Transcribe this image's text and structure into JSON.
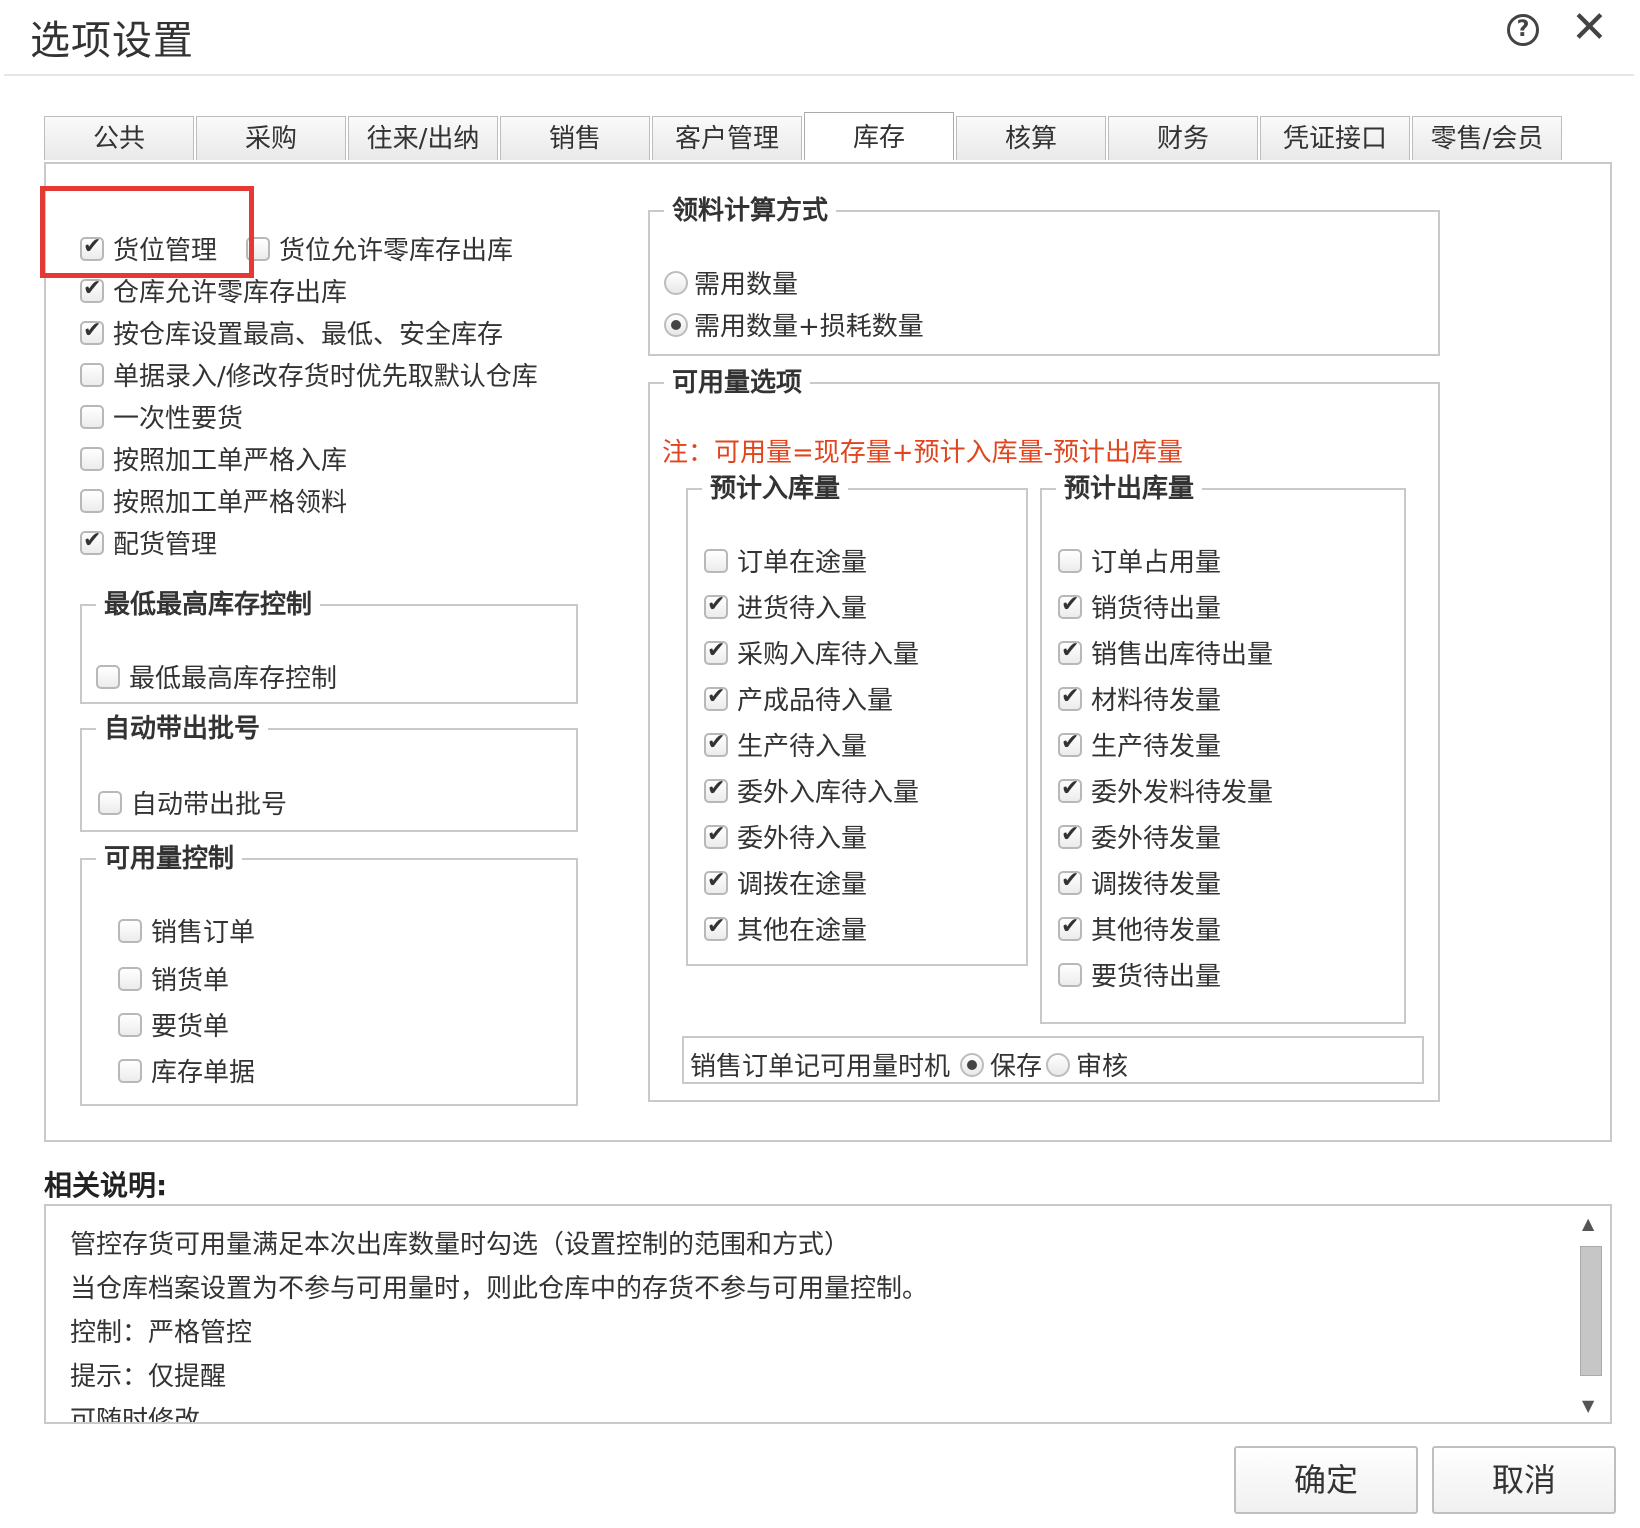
{
  "dialog": {
    "title": "选项设置",
    "help_icon": "?",
    "close_icon": "✕"
  },
  "tabs": [
    {
      "label": "公共",
      "active": false
    },
    {
      "label": "采购",
      "active": false
    },
    {
      "label": "往来/出纳",
      "active": false
    },
    {
      "label": "销售",
      "active": false
    },
    {
      "label": "客户管理",
      "active": false
    },
    {
      "label": "库存",
      "active": true
    },
    {
      "label": "核算",
      "active": false
    },
    {
      "label": "财务",
      "active": false
    },
    {
      "label": "凭证接口",
      "active": false
    },
    {
      "label": "零售/会员",
      "active": false
    }
  ],
  "left_options": {
    "location_mgmt": {
      "label": "货位管理",
      "checked": true
    },
    "location_zero_stock": {
      "label": "货位允许零库存出库",
      "checked": false
    },
    "warehouse_zero_stock": {
      "label": "仓库允许零库存出库",
      "checked": true
    },
    "warehouse_limits": {
      "label": "按仓库设置最高、最低、安全库存",
      "checked": true
    },
    "default_warehouse": {
      "label": "单据录入/修改存货时优先取默认仓库",
      "checked": false
    },
    "one_time_request": {
      "label": "一次性要货",
      "checked": false
    },
    "strict_inbound": {
      "label": "按照加工单严格入库",
      "checked": false
    },
    "strict_material": {
      "label": "按照加工单严格领料",
      "checked": false
    },
    "distribution_mgmt": {
      "label": "配货管理",
      "checked": true
    }
  },
  "min_max_group": {
    "title": "最低最高库存控制",
    "option": {
      "label": "最低最高库存控制",
      "checked": false
    }
  },
  "auto_batch_group": {
    "title": "自动带出批号",
    "option": {
      "label": "自动带出批号",
      "checked": false
    }
  },
  "availability_control_group": {
    "title": "可用量控制",
    "options": [
      {
        "label": "销售订单",
        "checked": false
      },
      {
        "label": "销货单",
        "checked": false
      },
      {
        "label": "要货单",
        "checked": false
      },
      {
        "label": "库存单据",
        "checked": false
      }
    ]
  },
  "material_calc_group": {
    "title": "领料计算方式",
    "options": [
      {
        "label": "需用数量",
        "selected": false
      },
      {
        "label": "需用数量+损耗数量",
        "selected": true
      }
    ]
  },
  "availability_options_group": {
    "title": "可用量选项",
    "note": "注：可用量=现存量+预计入库量-预计出库量",
    "inbound": {
      "title": "预计入库量",
      "options": [
        {
          "label": "订单在途量",
          "checked": false
        },
        {
          "label": "进货待入量",
          "checked": true
        },
        {
          "label": "采购入库待入量",
          "checked": true
        },
        {
          "label": "产成品待入量",
          "checked": true
        },
        {
          "label": "生产待入量",
          "checked": true
        },
        {
          "label": "委外入库待入量",
          "checked": true
        },
        {
          "label": "委外待入量",
          "checked": true
        },
        {
          "label": "调拨在途量",
          "checked": true
        },
        {
          "label": "其他在途量",
          "checked": true
        }
      ]
    },
    "outbound": {
      "title": "预计出库量",
      "options": [
        {
          "label": "订单占用量",
          "checked": false
        },
        {
          "label": "销货待出量",
          "checked": true
        },
        {
          "label": "销售出库待出量",
          "checked": true
        },
        {
          "label": "材料待发量",
          "checked": true
        },
        {
          "label": "生产待发量",
          "checked": true
        },
        {
          "label": "委外发料待发量",
          "checked": true
        },
        {
          "label": "委外待发量",
          "checked": true
        },
        {
          "label": "调拨待发量",
          "checked": true
        },
        {
          "label": "其他待发量",
          "checked": true
        },
        {
          "label": "要货待出量",
          "checked": false
        }
      ]
    },
    "timing": {
      "label": "销售订单记可用量时机",
      "options": [
        {
          "label": "保存",
          "selected": true
        },
        {
          "label": "审核",
          "selected": false
        }
      ]
    }
  },
  "description": {
    "title": "相关说明:",
    "lines": [
      "管控存货可用量满足本次出库数量时勾选（设置控制的范围和方式）",
      "当仓库档案设置为不参与可用量时，则此仓库中的存货不参与可用量控制。",
      "控制：严格管控",
      "提示：仅提醒",
      "可随时修改"
    ]
  },
  "buttons": {
    "ok": "确定",
    "cancel": "取消"
  },
  "colors": {
    "highlight": "#e53935",
    "note": "#e0451e"
  }
}
